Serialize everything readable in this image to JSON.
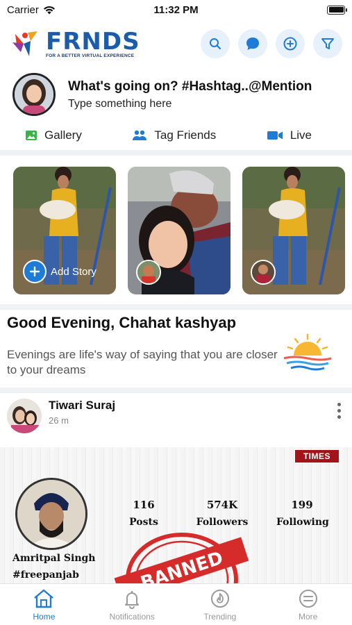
{
  "status_bar": {
    "carrier": "Carrier",
    "time": "11:32 PM"
  },
  "header": {
    "logo_text": "FRNDS",
    "logo_tagline": "FOR A BETTER VIRTUAL EXPERIENCE",
    "actions": [
      "search-icon",
      "chat-icon",
      "add-icon",
      "filter-icon"
    ],
    "accent": "#1e7bd6"
  },
  "composer": {
    "prompt": "What's going on? #Hashtag..@Mention",
    "placeholder": "Type something here",
    "actions": {
      "gallery": "Gallery",
      "tag_friends": "Tag Friends",
      "live": "Live"
    }
  },
  "stories": {
    "add_label": "Add Story"
  },
  "greeting": {
    "title": "Good Evening, Chahat kashyap",
    "text": "Evenings are life's way of saying that you are closer to your dreams"
  },
  "post": {
    "author": "Tiwari Suraj",
    "time": "26 m",
    "media": {
      "badge": "TIMES",
      "name": "Amritpal Singh",
      "handle": "#freepanjab",
      "stats": [
        {
          "value": "116",
          "label": "Posts"
        },
        {
          "value": "574K",
          "label": "Followers"
        },
        {
          "value": "199",
          "label": "Following"
        }
      ],
      "stamp_text": "BANNED"
    }
  },
  "tabbar": {
    "items": [
      {
        "label": "Home",
        "icon": "home-icon",
        "active": true
      },
      {
        "label": "Notifications",
        "icon": "bell-icon"
      },
      {
        "label": "Trending",
        "icon": "flame-icon"
      },
      {
        "label": "More",
        "icon": "menu-icon"
      }
    ]
  }
}
